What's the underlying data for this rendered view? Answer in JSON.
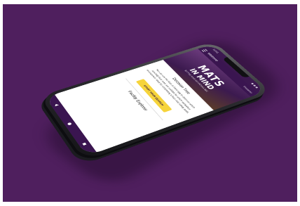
{
  "status_bar": {
    "time": "11:00"
  },
  "app_bar": {
    "title": "Welcome",
    "disclaimer": "Disclaimer"
  },
  "hero": {
    "title": "MATS",
    "subtitle": "IN MIND",
    "tagline": "MATTING YOUR ANTI-FATIGUE MAT"
  },
  "decision_tree": {
    "heading": "Decision Tree",
    "body": "You can use the Mats In Mind app to discover which specialty floor mats are suitable for which workplace environment. Ideal for completing a floor mat safety audit.",
    "button_label": "START YOUR SEARCH"
  },
  "facility_explorer": {
    "heading": "Facility Explorer"
  },
  "colors": {
    "background": "#4f1f5e",
    "app_bar": "#3a1550",
    "accent_button": "#f6d43b"
  },
  "icons": {
    "menu": "menu-icon",
    "back": "back-icon",
    "home": "home-icon",
    "recent": "recent-apps-icon"
  }
}
